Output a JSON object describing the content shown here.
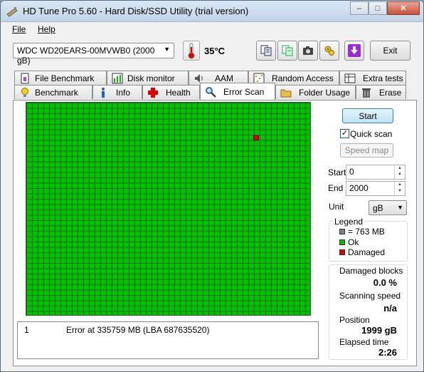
{
  "window": {
    "title": "HD Tune Pro 5.60 - Hard Disk/SSD Utility (trial version)",
    "controls": {
      "minimize": "–",
      "maximize": "□",
      "close": "✕"
    }
  },
  "menu": {
    "file": "File",
    "help": "Help"
  },
  "toolbar": {
    "drive": "WDC WD20EARS-00MVWB0 (2000 gB)",
    "temperature": "35°C",
    "exit": "Exit",
    "icons": [
      "copy-icon",
      "copy-info-icon",
      "camera-icon",
      "options-icon",
      "save-icon"
    ]
  },
  "tabs": {
    "row1": [
      {
        "label": "File Benchmark",
        "icon": "file-benchmark-icon"
      },
      {
        "label": "Disk monitor",
        "icon": "disk-monitor-icon"
      },
      {
        "label": "AAM",
        "icon": "speaker-icon"
      },
      {
        "label": "Random Access",
        "icon": "random-access-icon"
      },
      {
        "label": "Extra tests",
        "icon": "extra-tests-icon"
      }
    ],
    "row2": [
      {
        "label": "Benchmark",
        "icon": "lightbulb-icon"
      },
      {
        "label": "Info",
        "icon": "info-icon"
      },
      {
        "label": "Health",
        "icon": "health-cross-icon"
      },
      {
        "label": "Error Scan",
        "icon": "magnifier-icon"
      },
      {
        "label": "Folder Usage",
        "icon": "folder-icon"
      },
      {
        "label": "Erase",
        "icon": "trash-icon"
      }
    ],
    "active": "Error Scan"
  },
  "controls": {
    "start": "Start",
    "quick_scan": "Quick scan",
    "quick_scan_checked": true,
    "speed_map": "Speed map",
    "start_label": "Start",
    "start_value": "0",
    "end_label": "End",
    "end_value": "2000",
    "unit_label": "Unit",
    "unit_value": "gB"
  },
  "legend": {
    "title": "Legend",
    "block": "= 763 MB",
    "ok": "Ok",
    "damaged": "Damaged",
    "colors": {
      "block": "#808080",
      "ok": "#00c000",
      "damaged": "#e00000"
    }
  },
  "stats": {
    "damaged_blocks_label": "Damaged blocks",
    "damaged_blocks_value": "0.0 %",
    "scanning_speed_label": "Scanning speed",
    "scanning_speed_value": "n/a",
    "position_label": "Position",
    "position_value": "1999 gB",
    "elapsed_label": "Elapsed time",
    "elapsed_value": "2:26"
  },
  "log": [
    {
      "index": "1",
      "message": "Error at 335759 MB (LBA 687635520)"
    }
  ]
}
